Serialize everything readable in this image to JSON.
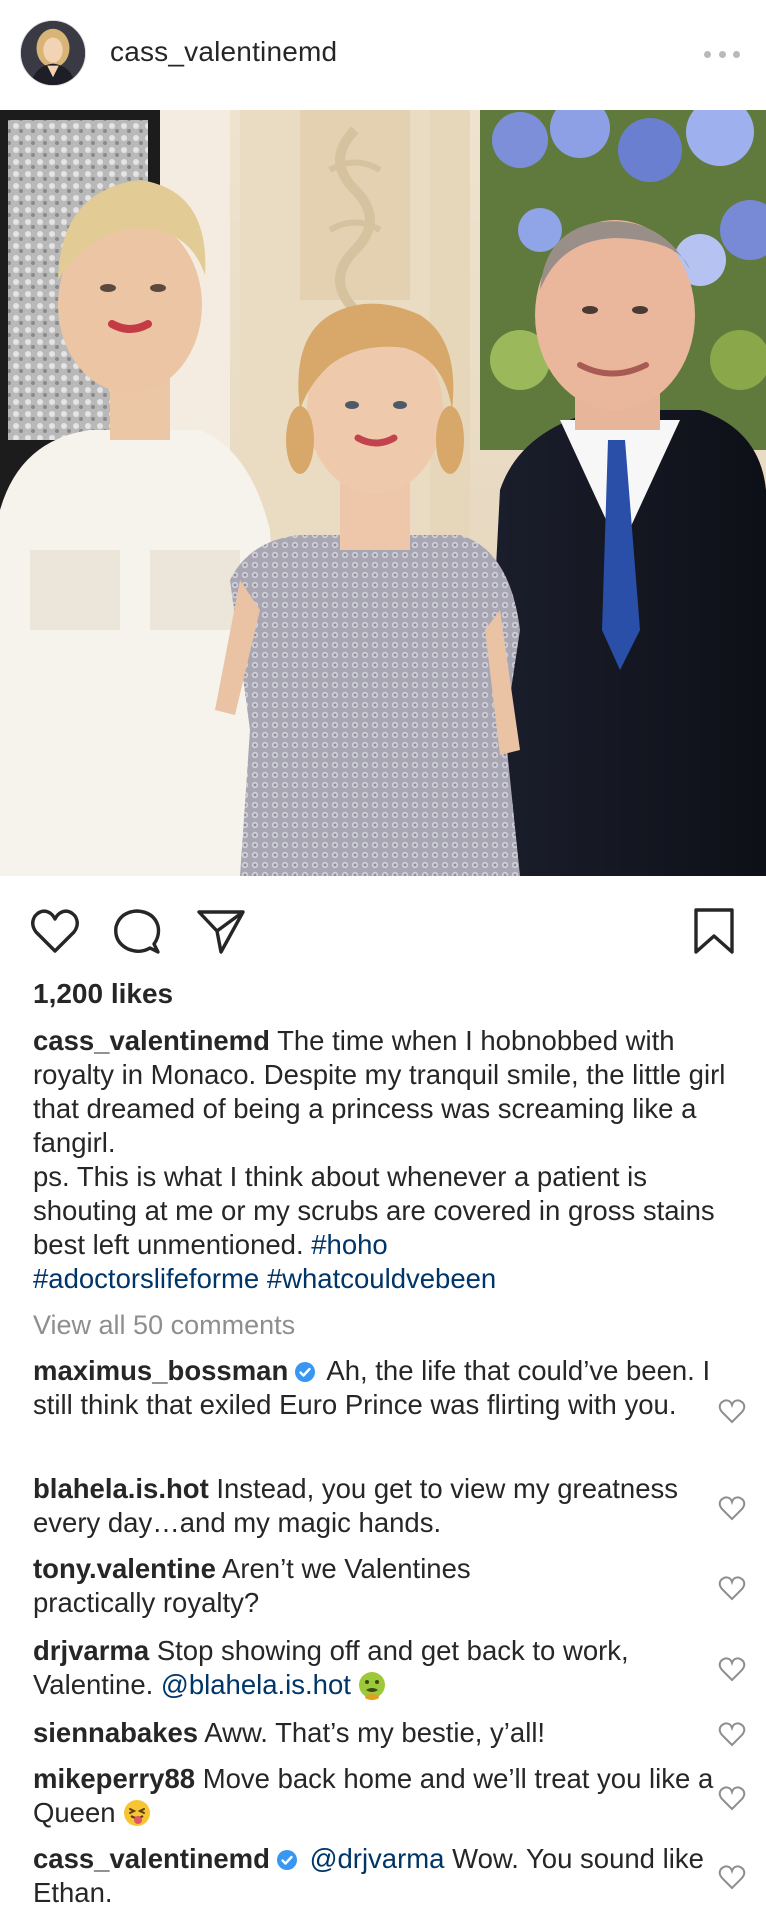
{
  "post": {
    "username": "cass_valentinemd",
    "likes": "1,200 likes",
    "caption": {
      "username": "cass_valentinemd",
      "text_1": "The time when I hobnobbed with royalty in Monaco. Despite my tranquil smile, the little girl that dreamed of being a princess was screaming like a fangirl.",
      "text_2": "ps. This is what I think about whenever a patient is shouting at me or my scrubs are covered in gross stains best left unmentioned.",
      "tag_1": "#hoho",
      "tag_2": "#adoctorslifeforme",
      "tag_3": "#whatcouldvebeen"
    },
    "view_all": "View all 50 comments"
  },
  "comments": [
    {
      "username": "maximus_bossman",
      "verified": true,
      "text": "Ah, the life that could’ve been. I still think that exiled Euro Prince was flirting with you."
    },
    {
      "username": "blahela.is.hot",
      "verified": false,
      "text": "Instead, you get to view my greatness every day…and my magic hands."
    },
    {
      "username": "tony.valentine",
      "verified": false,
      "text": "Aren’t we Valentines practically royalty?"
    },
    {
      "username": "drjvarma",
      "verified": false,
      "text": "Stop showing off and get back to work, Valentine.",
      "mention": "@blahela.is.hot",
      "emoji": "nauseated-face"
    },
    {
      "username": "siennabakes",
      "verified": false,
      "text": "Aww. That’s my bestie, y’all!"
    },
    {
      "username": "mikeperry88",
      "verified": false,
      "text": "Move back home and we’ll treat you like a Queen",
      "emoji": "tongue-wink-face"
    },
    {
      "username": "cass_valentinemd",
      "verified": true,
      "mention": "@drjvarma",
      "text": "Wow. You sound like Ethan."
    }
  ],
  "icons": {
    "like": "heart-icon",
    "comment": "comment-bubble-icon",
    "share": "paper-plane-icon",
    "save": "bookmark-icon",
    "more": "more-dots-icon",
    "verified": "verified-badge-icon",
    "comment_like": "small-heart-icon"
  },
  "colors": {
    "text": "#262626",
    "secondary": "#8e8e8e",
    "link": "#003569",
    "verified": "#3897f0"
  }
}
